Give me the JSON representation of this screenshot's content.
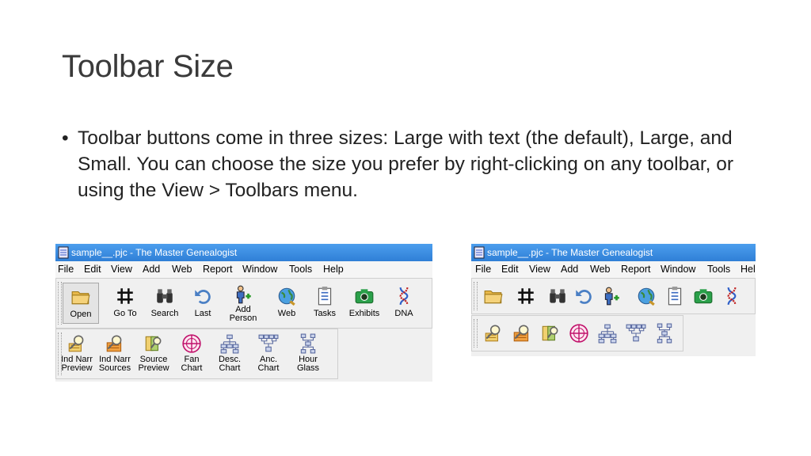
{
  "slide": {
    "title": "Toolbar Size",
    "bullet": "Toolbar buttons come in three sizes: Large with text (the default), Large, and Small. You can choose the size you prefer by right-clicking on any toolbar, or using the View > Toolbars menu."
  },
  "window": {
    "title": "sample__.pjc - The Master Genealogist"
  },
  "menu": {
    "file": "File",
    "edit": "Edit",
    "view": "View",
    "add": "Add",
    "web": "Web",
    "report": "Report",
    "window": "Window",
    "tools": "Tools",
    "help": "Help",
    "help_cut": "Hel"
  },
  "toolbar_main": [
    {
      "top": "Open",
      "bottom": "",
      "icon": "folder-icon"
    },
    {
      "top": "Go To",
      "bottom": "",
      "icon": "hash-icon"
    },
    {
      "top": "Search",
      "bottom": "",
      "icon": "binoculars-icon"
    },
    {
      "top": "Last",
      "bottom": "",
      "icon": "undo-arrow-icon"
    },
    {
      "top": "Add",
      "bottom": "Person",
      "icon": "add-person-icon"
    },
    {
      "top": "Web",
      "bottom": "",
      "icon": "globe-icon"
    },
    {
      "top": "Tasks",
      "bottom": "",
      "icon": "tasks-icon"
    },
    {
      "top": "Exhibits",
      "bottom": "",
      "icon": "camera-icon"
    },
    {
      "top": "DNA",
      "bottom": "",
      "icon": "dna-icon"
    }
  ],
  "toolbar_charts": [
    {
      "top": "Ind Narr",
      "bottom": "Preview",
      "icon": "ind-narr-preview-icon"
    },
    {
      "top": "Ind Narr",
      "bottom": "Sources",
      "icon": "ind-narr-sources-icon"
    },
    {
      "top": "Source",
      "bottom": "Preview",
      "icon": "source-preview-icon"
    },
    {
      "top": "Fan",
      "bottom": "Chart",
      "icon": "fan-chart-icon"
    },
    {
      "top": "Desc.",
      "bottom": "Chart",
      "icon": "descendant-chart-icon"
    },
    {
      "top": "Anc.",
      "bottom": "Chart",
      "icon": "ancestor-chart-icon"
    },
    {
      "top": "Hour",
      "bottom": "Glass",
      "icon": "hourglass-chart-icon"
    }
  ],
  "colors": {
    "titlebar": "#2f7fd6",
    "accent": "#c00000"
  }
}
